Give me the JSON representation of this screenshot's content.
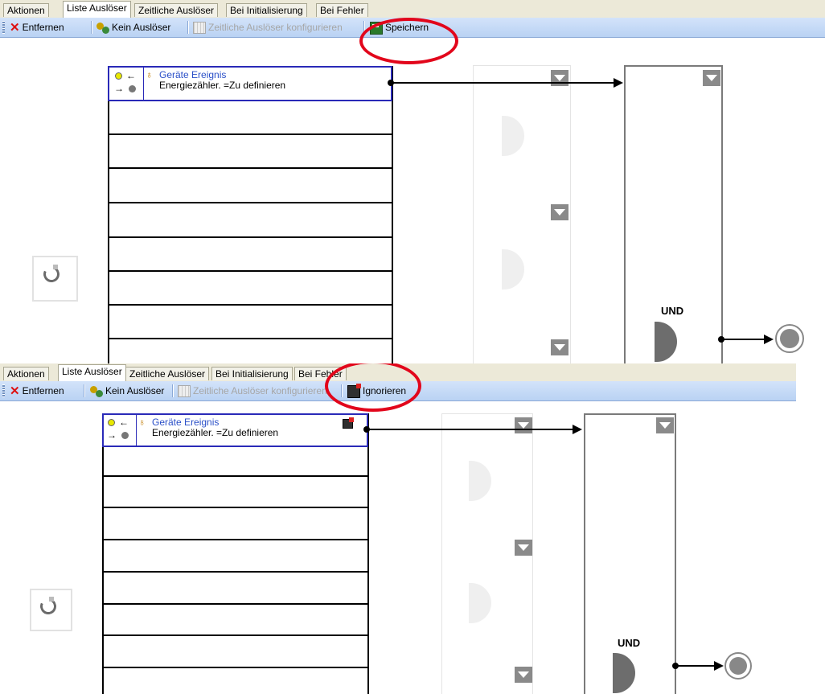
{
  "top": {
    "tabs": [
      "Aktionen",
      "Liste Auslöser",
      "Zeitliche Auslöser",
      "Bei Initialisierung",
      "Bei Fehler"
    ],
    "toolbar": {
      "remove": "Entfernen",
      "no_trigger": "Kein Auslöser",
      "configure_time": "Zeitliche Auslöser konfigurieren",
      "save": "Speichern"
    },
    "trigger": {
      "title": "Geräte Ereignis",
      "detail": "Energiezähler. =Zu definieren"
    },
    "gate_label": "UND"
  },
  "bottom": {
    "tabs": [
      "Aktionen",
      "Liste Auslöser",
      "Zeitliche Auslöser",
      "Bei Initialisierung",
      "Bei Fehler"
    ],
    "toolbar": {
      "remove": "Entfernen",
      "no_trigger": "Kein Auslöser",
      "configure_time": "Zeitliche Auslöser konfigurieren",
      "ignore": "Ignorieren"
    },
    "trigger": {
      "title": "Geräte Ereignis",
      "detail": "Energiezähler. =Zu definieren"
    },
    "gate_label": "UND"
  },
  "highlight_color": "#e2061b"
}
